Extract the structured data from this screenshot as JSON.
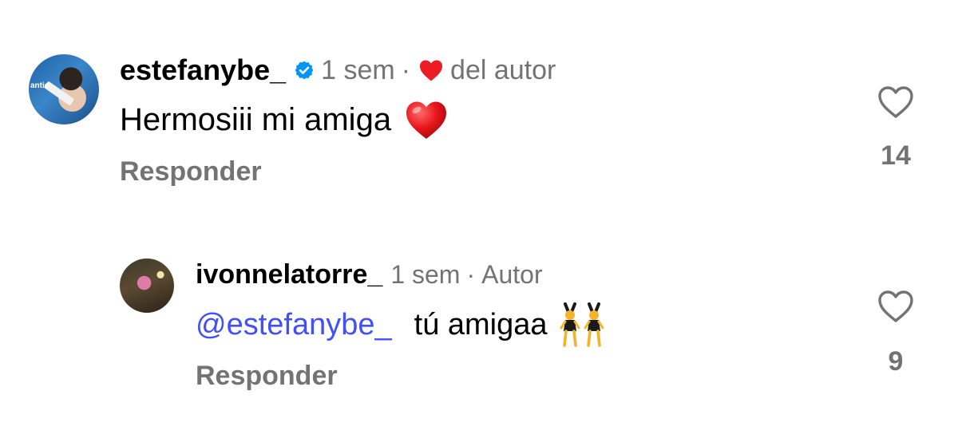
{
  "comments": [
    {
      "username": "estefanybe_",
      "verified": true,
      "time": "1 sem",
      "separator": "·",
      "author_reaction": "del autor",
      "text": "Hermosiii mi amiga",
      "text_emoji": "heart-emoji",
      "reply_label": "Responder",
      "likes": "14",
      "avatar_brand_text": "antie"
    },
    {
      "username": "ivonnelatorre_",
      "time": "1 sem",
      "separator": "·",
      "author_label": "Autor",
      "mention": "@estefanybe_",
      "text": "tú amigaa",
      "text_emoji": "women-with-bunny-ears-emoji",
      "reply_label": "Responder",
      "likes": "9"
    }
  ],
  "colors": {
    "meta_gray": "#737373",
    "mention_blue": "#4150f7",
    "heart_red": "#ed1c24",
    "verified_blue": "#0095f6"
  },
  "icons": {
    "verified": "verified-badge-icon",
    "author_heart": "red-heart-icon",
    "like": "heart-outline-icon"
  }
}
